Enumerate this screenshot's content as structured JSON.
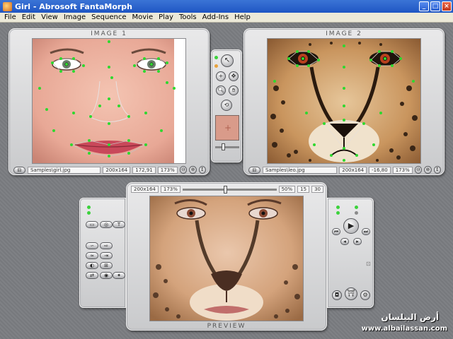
{
  "window": {
    "title": "Girl - Abrosoft FantaMorph",
    "minimize": "_",
    "maximize": "□",
    "close": "×"
  },
  "menu": [
    "File",
    "Edit",
    "View",
    "Image",
    "Sequence",
    "Movie",
    "Play",
    "Tools",
    "Add-Ins",
    "Help"
  ],
  "image1": {
    "title": "IMAGE 1",
    "path": "Samples\\girl.jpg",
    "size": "200x164",
    "coords": "172,91",
    "zoom": "173%"
  },
  "image2": {
    "title": "IMAGE 2",
    "path": "Samples\\leo.jpg",
    "size": "200x164",
    "coords": "-16,80",
    "zoom": "173%"
  },
  "preview": {
    "title": "PREVIEW",
    "size": "200x164",
    "zoom": "173%",
    "percent": "50%",
    "frame": "15",
    "total": "30"
  },
  "watermark": {
    "arabic": "أرض البيلسان",
    "url": "www.albailassan.com"
  },
  "colors": {
    "titlebar": "#1f56c4",
    "panel": "#d8d8da",
    "point": "#2fd82f"
  }
}
